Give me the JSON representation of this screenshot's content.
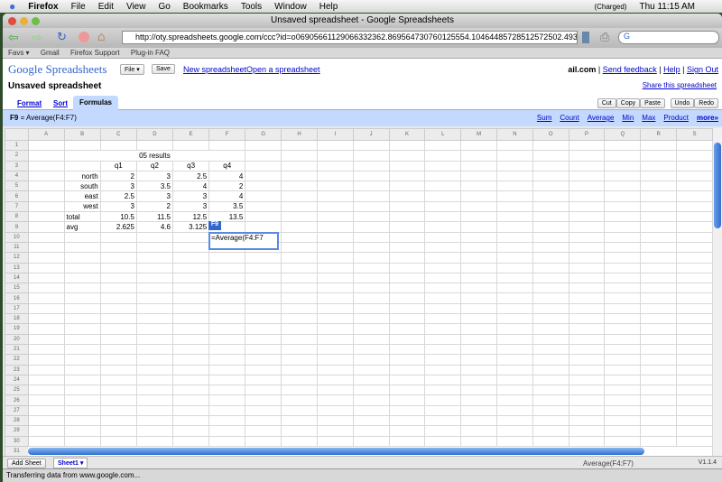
{
  "menubar": {
    "app": "Firefox",
    "items": [
      "File",
      "Edit",
      "View",
      "Go",
      "Bookmarks",
      "Tools",
      "Window",
      "Help"
    ],
    "battery": "(Charged)",
    "clock": "Thu 11:15 AM"
  },
  "window": {
    "title": "Unsaved spreadsheet - Google Spreadsheets"
  },
  "browser": {
    "url": "http://oty.spreadsheets.google.com/ccc?id=o06905661129066332362.869564730760125554.10464485728512572502.493",
    "search_placeholder": "G"
  },
  "bookmarks": [
    "Favs ▾",
    "Gmail",
    "Firefox Support",
    "Plug-in FAQ"
  ],
  "app": {
    "logo": "Google Spreadsheets",
    "file": "File ▾",
    "save": "Save",
    "new": "New spreadsheet",
    "open": "Open a spreadsheet",
    "account": "ail.com",
    "feedback": "Send feedback",
    "help": "Help",
    "signout": "Sign Out",
    "doc_title": "Unsaved spreadsheet",
    "share": "Share this spreadsheet"
  },
  "tabs": [
    "Format",
    "Sort",
    "Formulas"
  ],
  "edit_buttons": [
    "Cut",
    "Copy",
    "Paste",
    "Undo",
    "Redo"
  ],
  "formula_bar": {
    "cell": "F9",
    "formula": " = Average(F4:F7)",
    "shortcuts": [
      "Sum",
      "Count",
      "Average",
      "Min",
      "Max",
      "Product",
      "more»"
    ]
  },
  "grid": {
    "columns": [
      "A",
      "B",
      "C",
      "D",
      "E",
      "F",
      "G",
      "H",
      "I",
      "J",
      "K",
      "L",
      "M",
      "N",
      "O",
      "P",
      "Q",
      "R",
      "S"
    ],
    "title_cell": "05 results",
    "rows": [
      [],
      [],
      [
        "",
        "",
        "q1",
        "q2",
        "q3",
        "q4"
      ],
      [
        "",
        "north",
        "2",
        "3",
        "2.5",
        "4"
      ],
      [
        "",
        "south",
        "3",
        "3.5",
        "4",
        "2"
      ],
      [
        "",
        "east",
        "2.5",
        "3",
        "3",
        "4"
      ],
      [
        "",
        "west",
        "3",
        "2",
        "3",
        "3.5"
      ],
      [
        "",
        "total",
        "10.5",
        "11.5",
        "12.5",
        "13.5"
      ],
      [
        "",
        "avg",
        "2.625",
        "4.6",
        "3.125",
        ""
      ]
    ],
    "row_count": 31,
    "active_cell_label": "F9",
    "editor_value": "=Average(F4:F7"
  },
  "bottom": {
    "add_sheet": "Add Sheet",
    "sheet": "Sheet1 ▾",
    "formula_preview": "Average(F4:F7)",
    "version": "V1.1.4"
  },
  "status": "Transferring data from www.google.com..."
}
